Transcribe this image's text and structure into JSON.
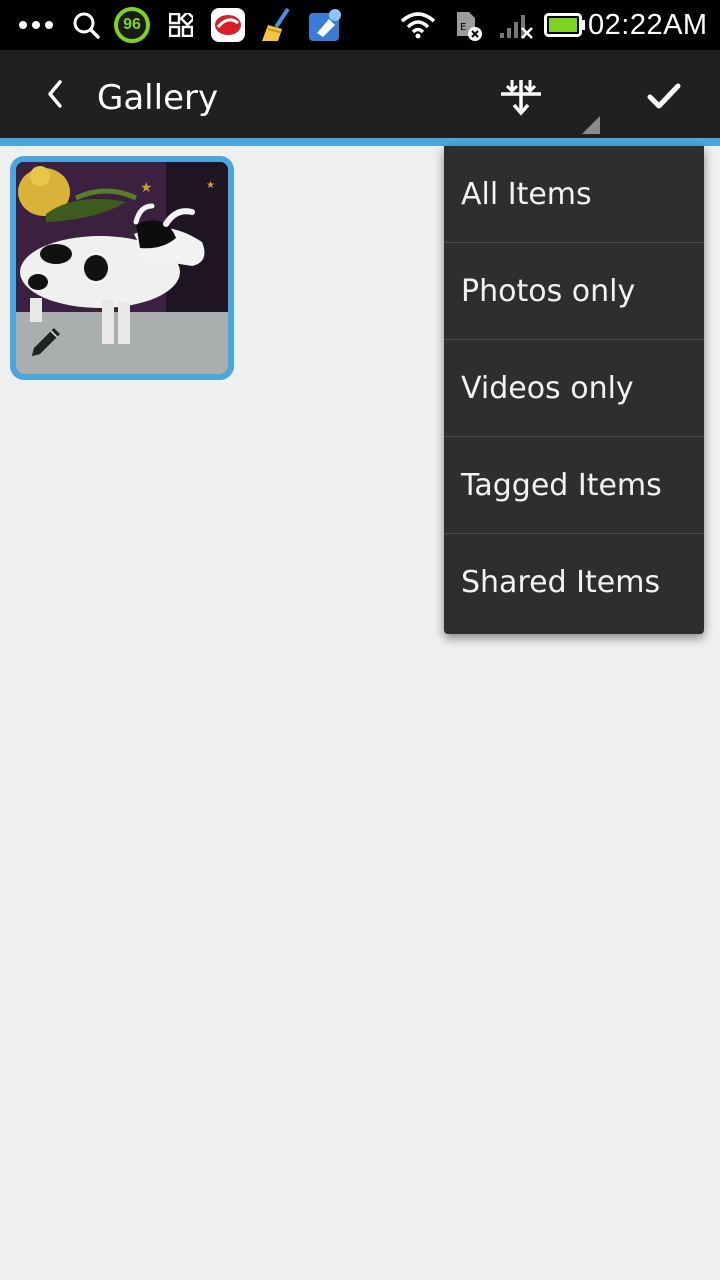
{
  "status_bar": {
    "time": "02:22AM",
    "badge_value": "96",
    "icons": [
      "more-dots-icon",
      "search-icon",
      "cleaner-badge-icon",
      "qr-code-icon",
      "app-red-icon",
      "broom-icon",
      "app-blue-icon",
      "wifi-icon",
      "sim-error-icon",
      "signal-off-icon",
      "battery-icon"
    ]
  },
  "action_bar": {
    "title": "Gallery",
    "back_icon": "chevron-left-icon",
    "filter_icon": "filter-sort-icon",
    "confirm_icon": "checkmark-icon"
  },
  "gallery": {
    "items": [
      {
        "type": "photo",
        "subject": "cow figurine",
        "edit_icon": "pencil-icon"
      }
    ]
  },
  "filter_menu": {
    "items": [
      {
        "label": "All Items"
      },
      {
        "label": "Photos only"
      },
      {
        "label": "Videos only"
      },
      {
        "label": "Tagged Items"
      },
      {
        "label": "Shared Items"
      }
    ]
  },
  "colors": {
    "accent": "#4aa6dc",
    "action_bar": "#211f20",
    "menu_bg": "#2e2e2e",
    "page_bg": "#eef0ef"
  }
}
